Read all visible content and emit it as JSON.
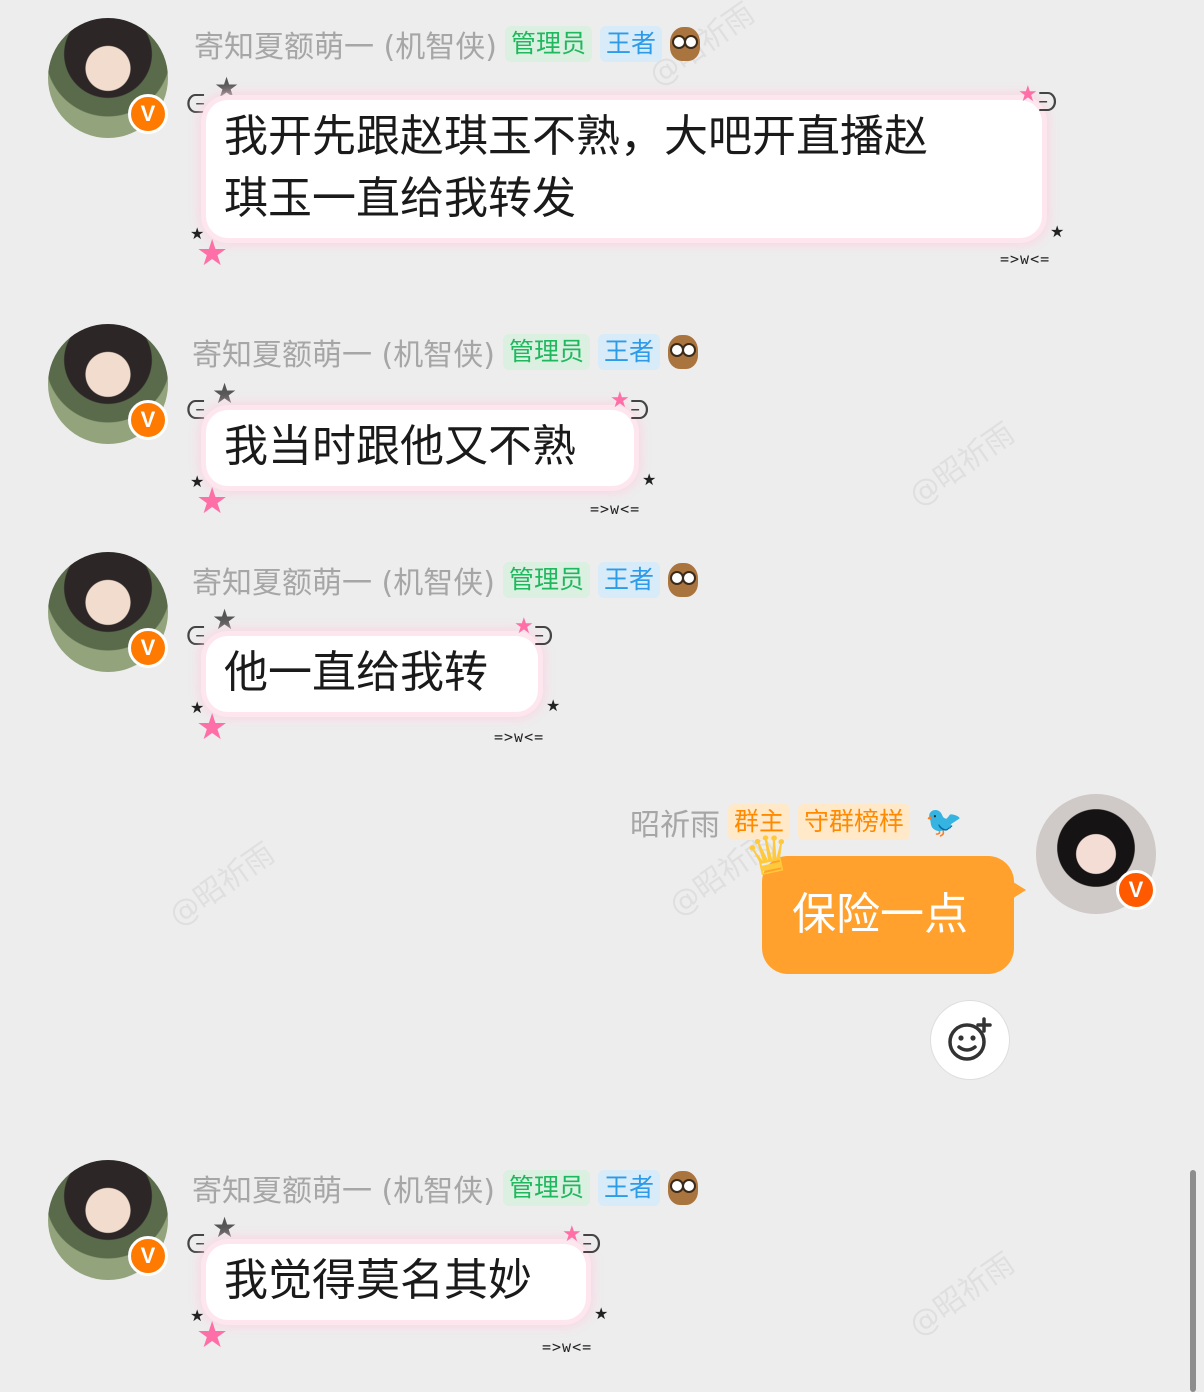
{
  "watermark": "@昭祈雨",
  "sender_name": "寄知夏额萌一 (机智侠)",
  "badges": {
    "admin": "管理员",
    "king": "王者",
    "owner": "群主",
    "model": "守群榜样",
    "vip": "V"
  },
  "kaomoji": "=>w<=",
  "messages": [
    {
      "text_lines": [
        "我开先跟赵琪玉不熟，大吧开直播赵",
        "琪玉一直给我转发"
      ]
    },
    {
      "text": "我当时跟他又不熟"
    },
    {
      "text": "他一直给我转"
    },
    {
      "text": "我觉得莫名其妙"
    }
  ],
  "self_message": {
    "name": "昭祈雨",
    "text": "保险一点"
  },
  "icons": [
    "owl-icon",
    "bird-icon",
    "crown-icon",
    "smiley-add-icon",
    "vip-badge-icon"
  ],
  "colors": {
    "admin": "#1fb85f",
    "king": "#2e9be8",
    "owner": "#ff8a00",
    "self_bubble": "#ffa12c"
  }
}
